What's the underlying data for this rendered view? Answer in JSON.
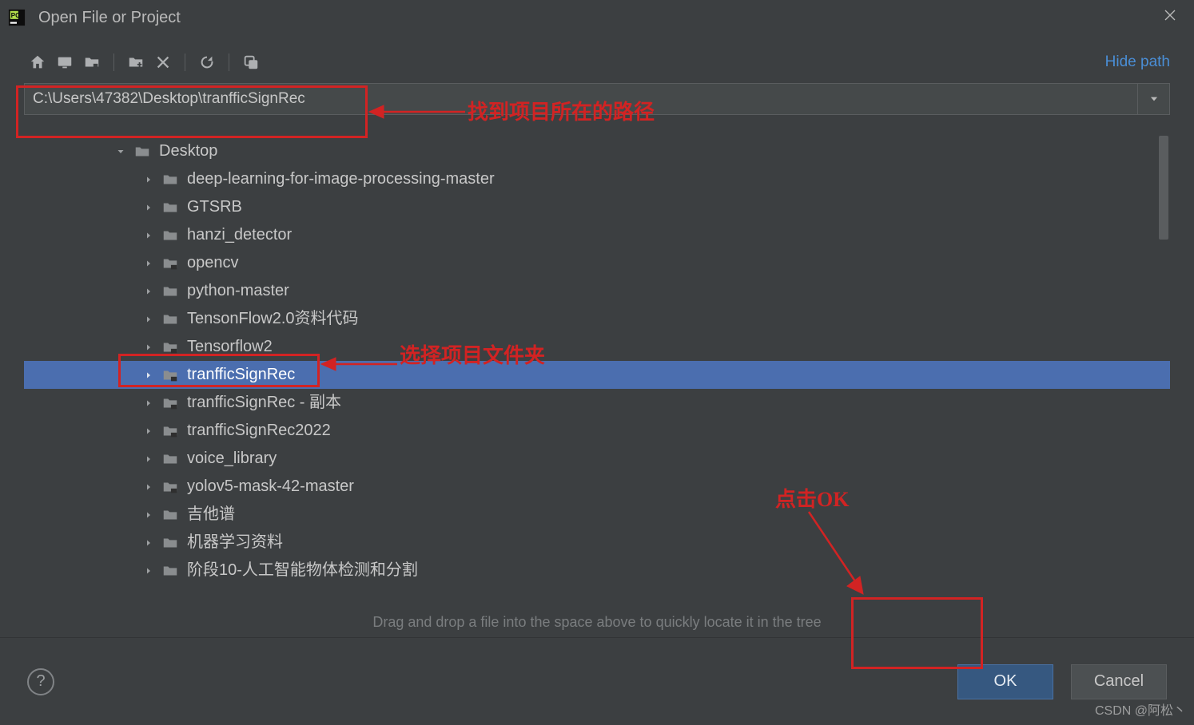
{
  "window": {
    "title": "Open File or Project"
  },
  "toolbar": {
    "hide_path": "Hide path",
    "icons": {
      "home": "home-icon",
      "desktop": "desktop-icon",
      "project": "project-folder-icon",
      "new_folder": "new-folder-icon",
      "delete": "delete-icon",
      "refresh": "refresh-icon",
      "show_hidden": "show-hidden-icon"
    }
  },
  "path": {
    "value": "C:\\Users\\47382\\Desktop\\tranfficSignRec"
  },
  "tree": {
    "root": {
      "label": "Desktop",
      "expanded": true
    },
    "items": [
      {
        "label": "deep-learning-for-image-processing-master",
        "kind": "folder",
        "selected": false
      },
      {
        "label": "GTSRB",
        "kind": "folder",
        "selected": false
      },
      {
        "label": "hanzi_detector",
        "kind": "folder",
        "selected": false
      },
      {
        "label": "opencv",
        "kind": "module",
        "selected": false
      },
      {
        "label": "python-master",
        "kind": "folder",
        "selected": false
      },
      {
        "label": "TensonFlow2.0资料代码",
        "kind": "folder",
        "selected": false
      },
      {
        "label": "Tensorflow2",
        "kind": "module",
        "selected": false
      },
      {
        "label": "tranfficSignRec",
        "kind": "module",
        "selected": true
      },
      {
        "label": "tranfficSignRec - 副本",
        "kind": "module",
        "selected": false
      },
      {
        "label": "tranfficSignRec2022",
        "kind": "module",
        "selected": false
      },
      {
        "label": "voice_library",
        "kind": "folder",
        "selected": false
      },
      {
        "label": "yolov5-mask-42-master",
        "kind": "module",
        "selected": false
      },
      {
        "label": "吉他谱",
        "kind": "folder",
        "selected": false
      },
      {
        "label": "机器学习资料",
        "kind": "folder",
        "selected": false
      },
      {
        "label": "阶段10-人工智能物体检测和分割",
        "kind": "folder",
        "selected": false
      }
    ]
  },
  "hint": "Drag and drop a file into the space above to quickly locate it in the tree",
  "buttons": {
    "ok": "OK",
    "cancel": "Cancel",
    "help_tooltip": "?"
  },
  "annotations": {
    "path_label": "找到项目所在的路径",
    "select_label": "选择项目文件夹",
    "ok_label": "点击OK"
  },
  "watermark": "CSDN @阿松丶"
}
